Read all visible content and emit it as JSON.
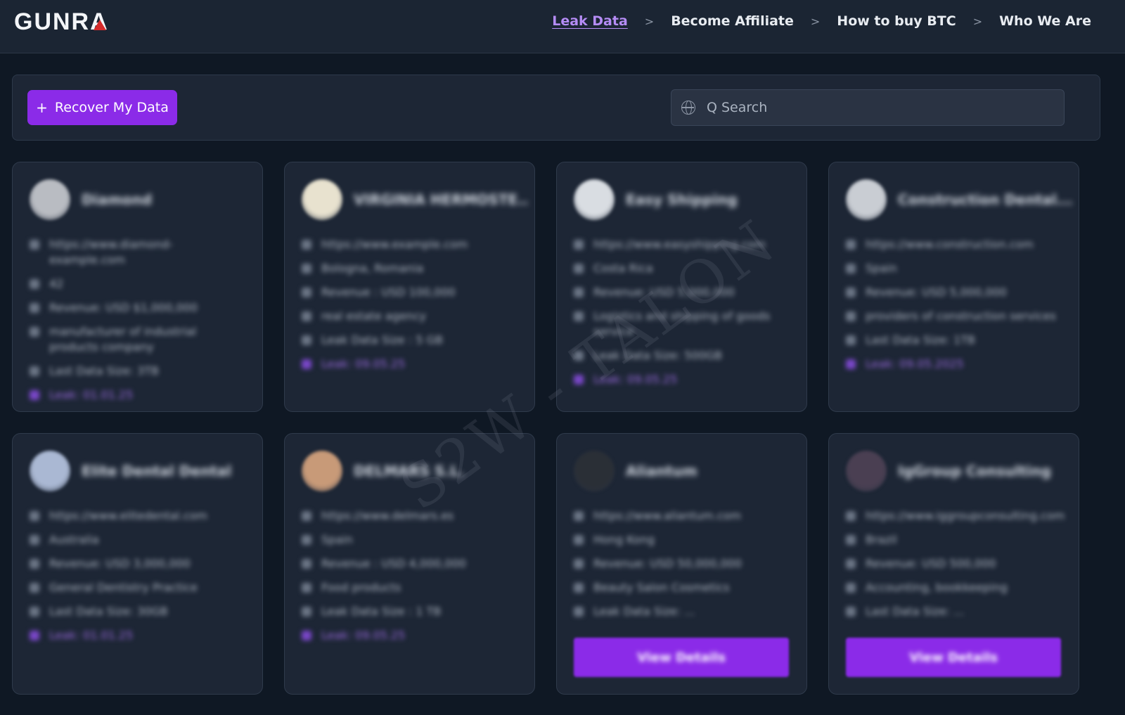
{
  "logo": {
    "text": "GUNRA"
  },
  "nav": {
    "items": [
      {
        "label": "Leak Data",
        "active": true
      },
      {
        "label": "Become Affiliate",
        "active": false
      },
      {
        "label": "How to buy BTC",
        "active": false
      },
      {
        "label": "Who We Are",
        "active": false
      }
    ],
    "separator": ">"
  },
  "toolbar": {
    "recover_icon": "+",
    "recover_label": "Recover My Data",
    "search_placeholder": "Q Search",
    "search_icon": "globe-icon"
  },
  "watermark": "S2W - TALON",
  "colors": {
    "accent": "#8b2be8",
    "nav_active": "#b58cf5",
    "background": "#0f1824",
    "card": "#1d2635"
  },
  "cards": [
    {
      "title": "Diamond",
      "avatar_color": "#b9bcc2",
      "rows": [
        "https://www.diamond-example.com",
        "42",
        "Revenue: USD $1,000,000",
        "manufacturer of industrial products company",
        "Last Data Size: 3TB",
        "Leak: 01.01.25"
      ],
      "view_label": ""
    },
    {
      "title": "VIRGINIA HERMOSTE...",
      "avatar_color": "#e8e2cf",
      "rows": [
        "https://www.example.com",
        "Bologna, Romania",
        "Revenue : USD 100,000",
        "real estate agency",
        "Leak Data Size : 5 GB",
        "Leak: 09.05.25"
      ],
      "view_label": ""
    },
    {
      "title": "Easy Shipping",
      "avatar_color": "#d9dde2",
      "rows": [
        "https://www.easyshipping.com",
        "Costa Rica",
        "Revenue: USD 5,000,000",
        "Logistics and shipping of goods service",
        "Leak Data Size: 500GB",
        "Leak: 09.05.25"
      ],
      "view_label": ""
    },
    {
      "title": "Construction Dental...",
      "avatar_color": "#c9cdd3",
      "rows": [
        "https://www.construction.com",
        "Spain",
        "Revenue: USD 5,000,000",
        "providers of construction services",
        "Last Data Size: 1TB",
        "Leak: 09.05.2025"
      ],
      "view_label": ""
    },
    {
      "title": "Elite Dental Dental",
      "avatar_color": "#aab8d3",
      "rows": [
        "https://www.elitedental.com",
        "Australia",
        "Revenue: USD 3,000,000",
        "General Dentistry Practice",
        "Last Data Size: 30GB",
        "Leak: 01.01.25"
      ],
      "view_label": ""
    },
    {
      "title": "DELMARS S.L.",
      "avatar_color": "#c89a78",
      "rows": [
        "https://www.delmars.es",
        "Spain",
        "Revenue : USD 4,000,000",
        "Food products",
        "Leak Data Size : 1 TB",
        "Leak: 09.05.25"
      ],
      "view_label": ""
    },
    {
      "title": "Aliantum",
      "avatar_color": "#2a2f36",
      "rows": [
        "https://www.aliantum.com",
        "Hong Kong",
        "Revenue: USD 50,000,000",
        "Beauty Salon Cosmetics",
        "Leak Data Size: ...",
        ""
      ],
      "view_label": "View Details"
    },
    {
      "title": "IgGroup Consulting",
      "avatar_color": "#4a3f52",
      "rows": [
        "https://www.iggroupconsulting.com",
        "Brazil",
        "Revenue: USD 500,000",
        "Accounting, bookkeeping",
        "Last Data Size: ...",
        ""
      ],
      "view_label": "View Details"
    }
  ]
}
